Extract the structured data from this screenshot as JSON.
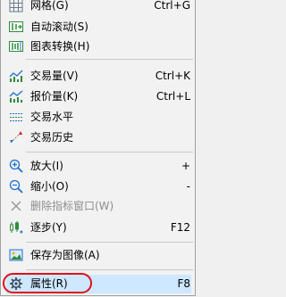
{
  "menu": {
    "items": [
      {
        "label": "网格(G)",
        "shortcut": "Ctrl+G",
        "icon": "grid-icon",
        "enabled": true
      },
      {
        "label": "自动滚动(S)",
        "shortcut": "",
        "icon": "autoscroll-icon",
        "enabled": true
      },
      {
        "label": "图表转换(H)",
        "shortcut": "",
        "icon": "chart-shift-icon",
        "enabled": true
      },
      {
        "label": "交易量(V)",
        "shortcut": "Ctrl+K",
        "icon": "trade-volume-icon",
        "enabled": true
      },
      {
        "label": "报价量(K)",
        "shortcut": "Ctrl+L",
        "icon": "tick-volume-icon",
        "enabled": true
      },
      {
        "label": "交易水平",
        "shortcut": "",
        "icon": "trade-levels-icon",
        "enabled": true
      },
      {
        "label": "交易历史",
        "shortcut": "",
        "icon": "trade-history-icon",
        "enabled": true
      },
      {
        "label": "放大(I)",
        "shortcut": "+",
        "icon": "zoom-in-icon",
        "enabled": true
      },
      {
        "label": "缩小(O)",
        "shortcut": "-",
        "icon": "zoom-out-icon",
        "enabled": true
      },
      {
        "label": "删除指标窗口(W)",
        "shortcut": "",
        "icon": "delete-window-icon",
        "enabled": false
      },
      {
        "label": "逐步(Y)",
        "shortcut": "F12",
        "icon": "step-icon",
        "enabled": true
      },
      {
        "label": "保存为图像(A)",
        "shortcut": "",
        "icon": "save-image-icon",
        "enabled": true
      },
      {
        "label": "属性(R)",
        "shortcut": "F8",
        "icon": "properties-gear-icon",
        "enabled": true,
        "highlighted": true
      }
    ]
  },
  "colors": {
    "highlight": "#cde8ff",
    "annotation_ring": "#e0101a",
    "icon_green": "#2e8b3a",
    "icon_blue": "#1e6fd0"
  }
}
